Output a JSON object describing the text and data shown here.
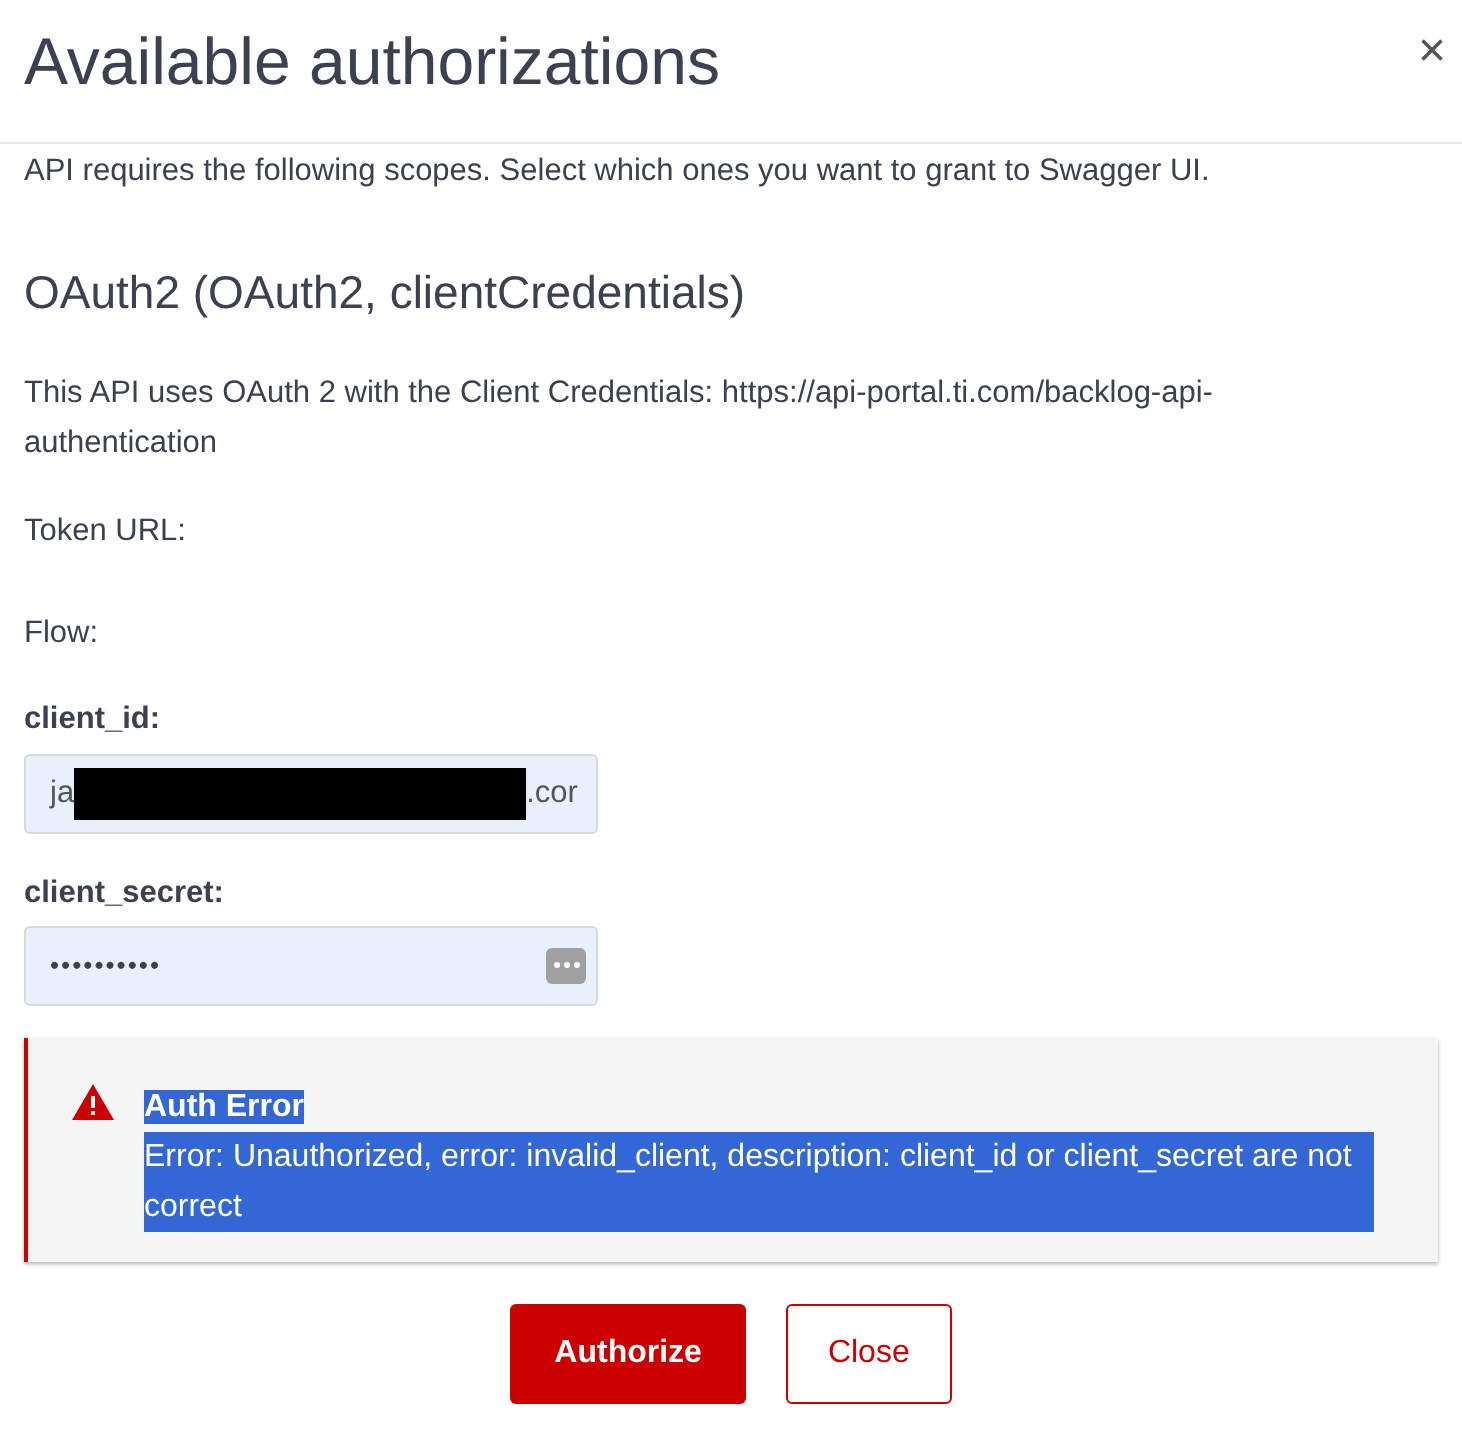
{
  "dialog": {
    "title": "Available authorizations",
    "close_icon": "×"
  },
  "intro": "API requires the following scopes. Select which ones you want to grant to Swagger UI.",
  "scheme": {
    "heading": "OAuth2 (OAuth2, clientCredentials)",
    "description": "This API uses OAuth 2 with the Client Credentials: https://api-portal.ti.com/backlog-api-authentication",
    "token_url_label": "Token URL:",
    "flow_label": "Flow:",
    "fields": [
      {
        "kind": "text",
        "label": "client_id:",
        "value_start": "ja",
        "redacted": true,
        "value_end": ".cor"
      },
      {
        "kind": "password",
        "label": "client_secret:",
        "value_start": "••••••••••",
        "redacted": false
      }
    ]
  },
  "error": {
    "title": "Auth Error",
    "message": "Error: Unauthorized, error: invalid_client, description: client_id or client_secret are not correct",
    "highlighted": true
  },
  "buttons": [
    {
      "kind": "primary",
      "label": "Authorize"
    },
    {
      "kind": "secondary",
      "label": "Close"
    }
  ]
}
